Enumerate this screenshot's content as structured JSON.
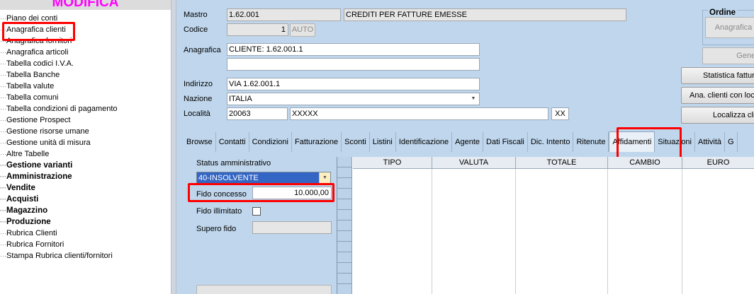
{
  "tree": {
    "title": "MODIFICA",
    "items": [
      {
        "label": "Piano dei conti",
        "bold": false
      },
      {
        "label": "Anagrafica clienti",
        "bold": false
      },
      {
        "label": "Anagrafica fornitori",
        "bold": false
      },
      {
        "label": "Anagrafica articoli",
        "bold": false
      },
      {
        "label": "Tabella codici I.V.A.",
        "bold": false
      },
      {
        "label": "Tabella Banche",
        "bold": false
      },
      {
        "label": "Tabella valute",
        "bold": false
      },
      {
        "label": "Tabella comuni",
        "bold": false
      },
      {
        "label": "Tabella condizioni di pagamento",
        "bold": false
      },
      {
        "label": "Gestione Prospect",
        "bold": false
      },
      {
        "label": "Gestione risorse umane",
        "bold": false
      },
      {
        "label": "Gestione unità di misura",
        "bold": false
      },
      {
        "label": "Altre Tabelle",
        "bold": false
      },
      {
        "label": "Gestione varianti",
        "bold": true
      },
      {
        "label": "Amministrazione",
        "bold": true
      },
      {
        "label": "Vendite",
        "bold": true
      },
      {
        "label": "Acquisti",
        "bold": true
      },
      {
        "label": "Magazzino",
        "bold": true
      },
      {
        "label": "Produzione",
        "bold": true
      },
      {
        "label": "Rubrica Clienti",
        "bold": false
      },
      {
        "label": "Rubrica Fornitori",
        "bold": false
      },
      {
        "label": "Stampa Rubrica clienti/fornitori",
        "bold": false
      }
    ]
  },
  "form": {
    "mastro_label": "Mastro",
    "mastro_code": "1.62.001",
    "mastro_desc": "CREDITI PER FATTURE EMESSE",
    "codice_label": "Codice",
    "codice_value": "1",
    "auto_label": "AUTO",
    "anagrafica_label": "Anagrafica",
    "anagrafica_line1": "CLIENTE:  1.62.001.1",
    "anagrafica_line2": "",
    "indirizzo_label": "Indirizzo",
    "indirizzo_value": "VIA 1.62.001.1",
    "nazione_label": "Nazione",
    "nazione_value": "ITALIA",
    "localita_label": "Località",
    "cap_value": "20063",
    "localita_value": "XXXXX",
    "prov_value": "XX"
  },
  "right_panel": {
    "ordine_label": "Ordine",
    "anagrafica_btn": "Anagrafica",
    "genera_btn": "Genera",
    "statistica_btn": "Statistica fatturato",
    "ana_clienti_btn": "Ana. clienti con località",
    "localizza_btn": "Localizza cliente"
  },
  "tabs": [
    {
      "label": "Browse",
      "active": false
    },
    {
      "label": "Contatti",
      "active": false
    },
    {
      "label": "Condizioni",
      "active": false
    },
    {
      "label": "Fatturazione",
      "active": false
    },
    {
      "label": "Sconti",
      "active": false
    },
    {
      "label": "Listini",
      "active": false
    },
    {
      "label": "Identificazione",
      "active": false
    },
    {
      "label": "Agente",
      "active": false
    },
    {
      "label": "Dati Fiscali",
      "active": false
    },
    {
      "label": "Dic. Intento",
      "active": false
    },
    {
      "label": "Ritenute",
      "active": false
    },
    {
      "label": "Affidamenti",
      "active": true
    },
    {
      "label": "Situazioni",
      "active": false
    },
    {
      "label": "Attività",
      "active": false
    },
    {
      "label": "G",
      "active": false
    }
  ],
  "affidamenti": {
    "status_label": "Status amministrativo",
    "status_value": "40-INSOLVENTE",
    "fido_label": "Fido concesso",
    "fido_value": "10.000,00",
    "fido_illimitato_label": "Fido illimitato",
    "supero_label": "Supero fido",
    "supero_value": ""
  },
  "grid": {
    "columns": [
      "TIPO",
      "VALUTA",
      "TOTALE",
      "CAMBIO",
      "EURO"
    ]
  },
  "colors": {
    "panel_bg": "#bfd6ec",
    "highlight": "#ff0000",
    "title": "#ff00ff",
    "combo_selected": "#3365c4"
  }
}
